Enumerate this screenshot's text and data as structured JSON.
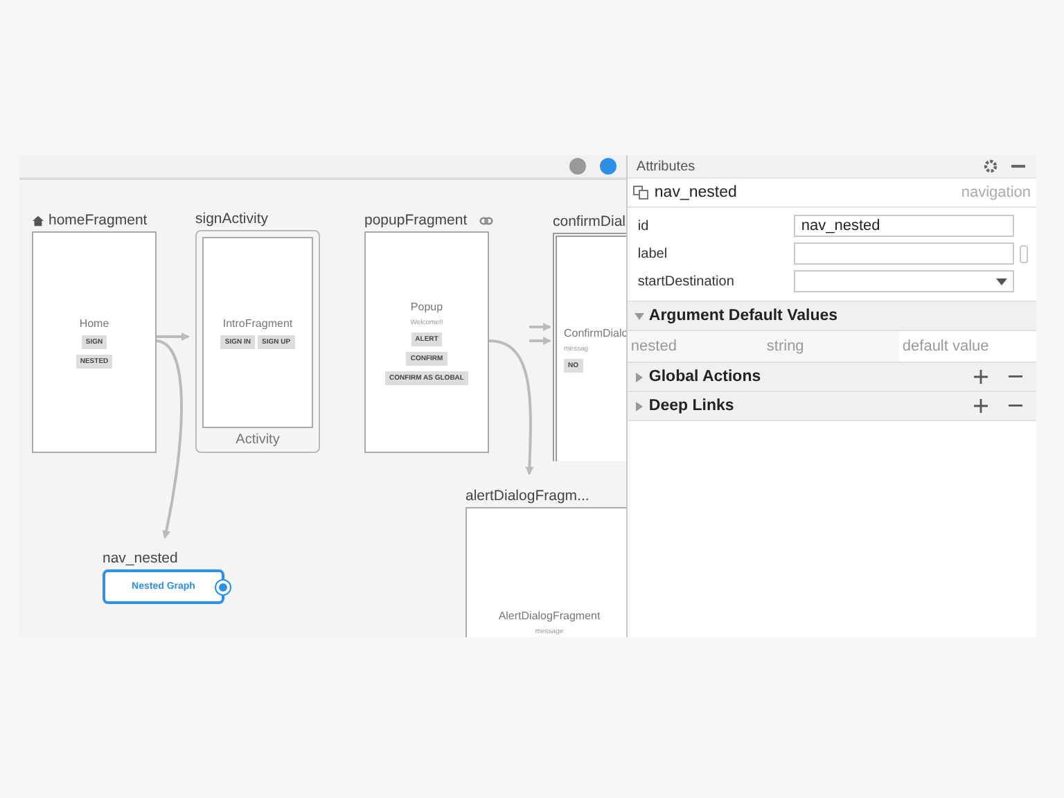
{
  "canvas": {
    "nodes": [
      {
        "kind": "fragment",
        "label": "homeFragment",
        "start": true,
        "deep_link": false,
        "selected": false,
        "title": "Home",
        "button_rows": [
          [
            "SIGN"
          ],
          [
            "NESTED"
          ]
        ]
      },
      {
        "kind": "activity",
        "label": "signActivity",
        "start": false,
        "deep_link": false,
        "selected": false,
        "title": "IntroFragment",
        "button_rows": [
          [
            "SIGN IN",
            "SIGN UP"
          ]
        ],
        "footer": "Activity"
      },
      {
        "kind": "fragment",
        "label": "popupFragment",
        "start": false,
        "deep_link": true,
        "selected": false,
        "title": "Popup",
        "lines": [
          "Welcome!!"
        ],
        "button_rows": [
          [
            "ALERT"
          ],
          [
            "CONFIRM"
          ],
          [
            "CONFIRM AS GLOBAL"
          ]
        ]
      },
      {
        "kind": "dialog",
        "label": "confirmDial",
        "start": false,
        "deep_link": false,
        "selected": false,
        "title": "ConfirmDialo",
        "lines": [
          "messag"
        ],
        "button_rows": [
          [
            "NO"
          ]
        ]
      },
      {
        "kind": "dialog",
        "label": "alertDialogFragm...",
        "start": false,
        "deep_link": false,
        "selected": false,
        "title": "AlertDialogFragment",
        "lines": [
          "message"
        ]
      },
      {
        "kind": "graph",
        "label": "nav_nested",
        "start": false,
        "deep_link": false,
        "selected": true,
        "title": "Nested Graph"
      }
    ]
  },
  "attributes": {
    "title": "Attributes",
    "element": {
      "name": "nav_nested",
      "type": "navigation"
    },
    "fields": [
      {
        "label": "id",
        "kind": "text",
        "value": "nav_nested"
      },
      {
        "label": "label",
        "kind": "text"
      },
      {
        "label": "startDestination",
        "kind": "dropdown"
      }
    ],
    "sections": [
      {
        "title": "Argument Default Values",
        "expanded": true,
        "addable": false,
        "rows": [
          [
            "nested",
            "string",
            "default value"
          ]
        ]
      },
      {
        "title": "Global Actions",
        "expanded": false,
        "addable": true
      },
      {
        "title": "Deep Links",
        "expanded": false,
        "addable": true
      }
    ]
  }
}
